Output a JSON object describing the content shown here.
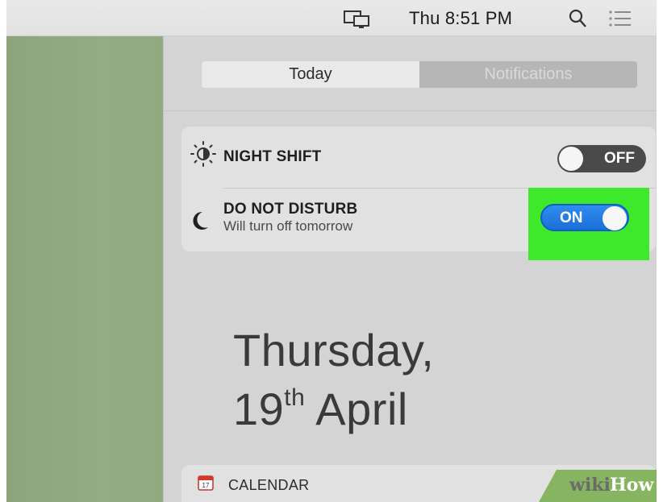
{
  "menubar": {
    "clock": "Thu 8:51 PM",
    "icons": [
      "screen-mirroring-icon",
      "search-icon",
      "notification-center-list-icon"
    ]
  },
  "tabs": {
    "today": "Today",
    "notifications": "Notifications",
    "selected": "Today"
  },
  "night_shift": {
    "label": "NIGHT SHIFT",
    "toggle": "OFF",
    "icon": "night-shift-sun-icon"
  },
  "do_not_disturb": {
    "label": "DO NOT DISTURB",
    "subtitle": "Will turn off tomorrow",
    "toggle": "ON",
    "icon": "moon-icon",
    "highlight_color": "#3ee82b"
  },
  "date": {
    "weekday": "Thursday,",
    "day": "19",
    "suffix": "th",
    "month": "April"
  },
  "calendar": {
    "title": "CALENDAR",
    "icon": "calendar-icon"
  },
  "watermark": {
    "wiki": "wiki",
    "how": "How"
  },
  "colors": {
    "toggle_on": "#1c6fd6",
    "toggle_off": "#4a4a4a",
    "wallpaper": "#93a982",
    "panel": "#d4d4d4"
  }
}
